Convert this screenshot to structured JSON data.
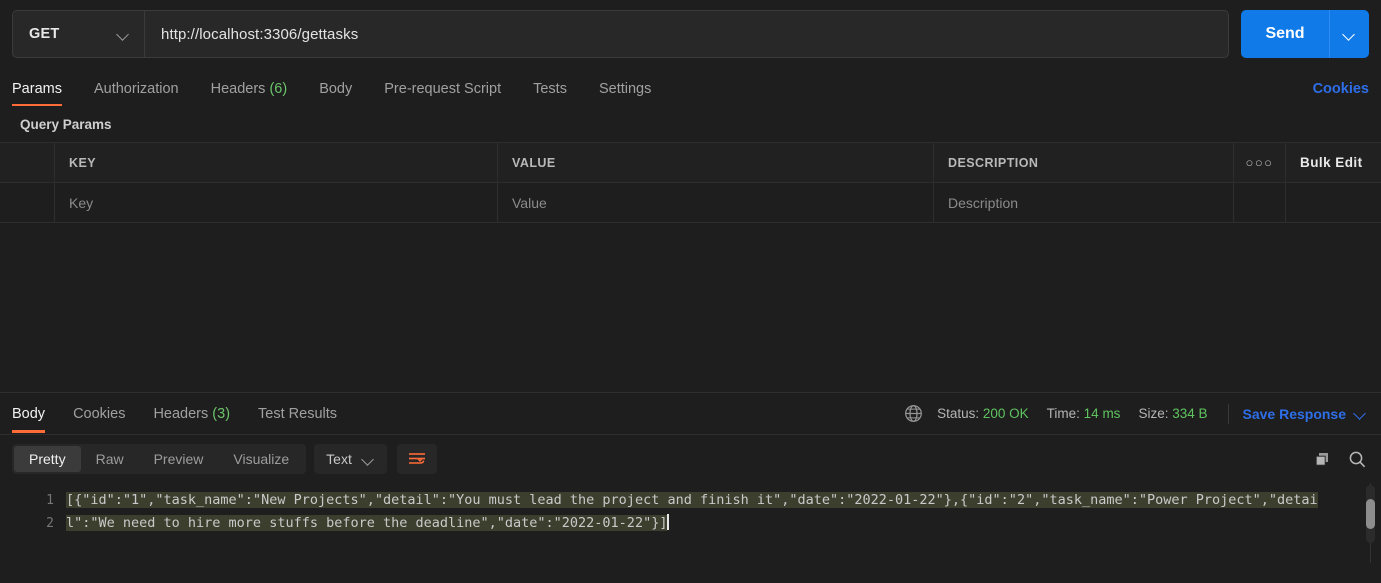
{
  "request": {
    "method": "GET",
    "url": "http://localhost:3306/gettasks",
    "send_label": "Send",
    "tabs": [
      {
        "label": "Params",
        "count": ""
      },
      {
        "label": "Authorization",
        "count": ""
      },
      {
        "label": "Headers",
        "count": "(6)"
      },
      {
        "label": "Body",
        "count": ""
      },
      {
        "label": "Pre-request Script",
        "count": ""
      },
      {
        "label": "Tests",
        "count": ""
      },
      {
        "label": "Settings",
        "count": ""
      }
    ],
    "cookies_link": "Cookies"
  },
  "params": {
    "section_title": "Query Params",
    "headers": {
      "key": "KEY",
      "value": "VALUE",
      "description": "DESCRIPTION"
    },
    "bulk_edit": "Bulk Edit",
    "dots": "○○○",
    "placeholders": {
      "key": "Key",
      "value": "Value",
      "description": "Description"
    }
  },
  "response": {
    "tabs": [
      {
        "label": "Body",
        "count": ""
      },
      {
        "label": "Cookies",
        "count": ""
      },
      {
        "label": "Headers",
        "count": "(3)"
      },
      {
        "label": "Test Results",
        "count": ""
      }
    ],
    "status_label": "Status:",
    "status_value": "200 OK",
    "time_label": "Time:",
    "time_value": "14 ms",
    "size_label": "Size:",
    "size_value": "334 B",
    "save_response": "Save Response",
    "format_tabs": [
      "Pretty",
      "Raw",
      "Preview",
      "Visualize"
    ],
    "active_format": "Pretty",
    "content_type": "Text",
    "line_numbers": [
      "1",
      "2"
    ],
    "body_text": "[{\"id\":\"1\",\"task_name\":\"New Projects\",\"detail\":\"You must lead the project and finish it\",\"date\":\"2022-01-22\"},{\"id\":\"2\",\"task_name\":\"Power Project\",\"detail\":\"We need to hire more stuffs before the deadline\",\"date\":\"2022-01-22\"}]"
  },
  "colors": {
    "accent_orange": "#ff6c37",
    "send_blue": "#0f7ae8",
    "link_blue": "#2e6ee8",
    "status_green": "#5fc45f",
    "background": "#1e1e1e"
  }
}
